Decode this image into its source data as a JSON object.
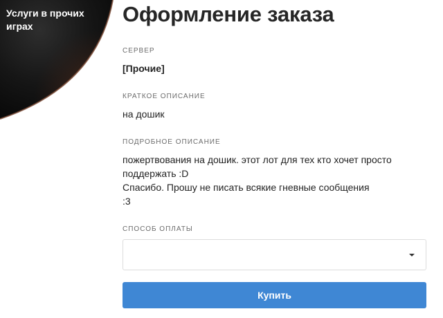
{
  "sidebar": {
    "category_title": "Услуги в прочих играх"
  },
  "order": {
    "title": "Оформление заказа",
    "server_label": "СЕРВЕР",
    "server_value": "[Прочие]",
    "short_desc_label": "КРАТКОЕ ОПИСАНИЕ",
    "short_desc_value": "на дошик",
    "full_desc_label": "ПОДРОБНОЕ ОПИСАНИЕ",
    "full_desc_lines": [
      "пожертвования на дошик. этот лот для тех кто хочет просто",
      "поддержать :D",
      "Спасибо. Прошу не писать всякие гневные сообщения",
      ":3"
    ],
    "payment_label": "СПОСОБ ОПЛАТЫ",
    "payment_selected": "",
    "dropdown_icon": "chevron-down-icon",
    "buy_label": "Купить"
  },
  "colors": {
    "accent": "#3f87d4",
    "corner_dark": "#1a1a1a"
  }
}
